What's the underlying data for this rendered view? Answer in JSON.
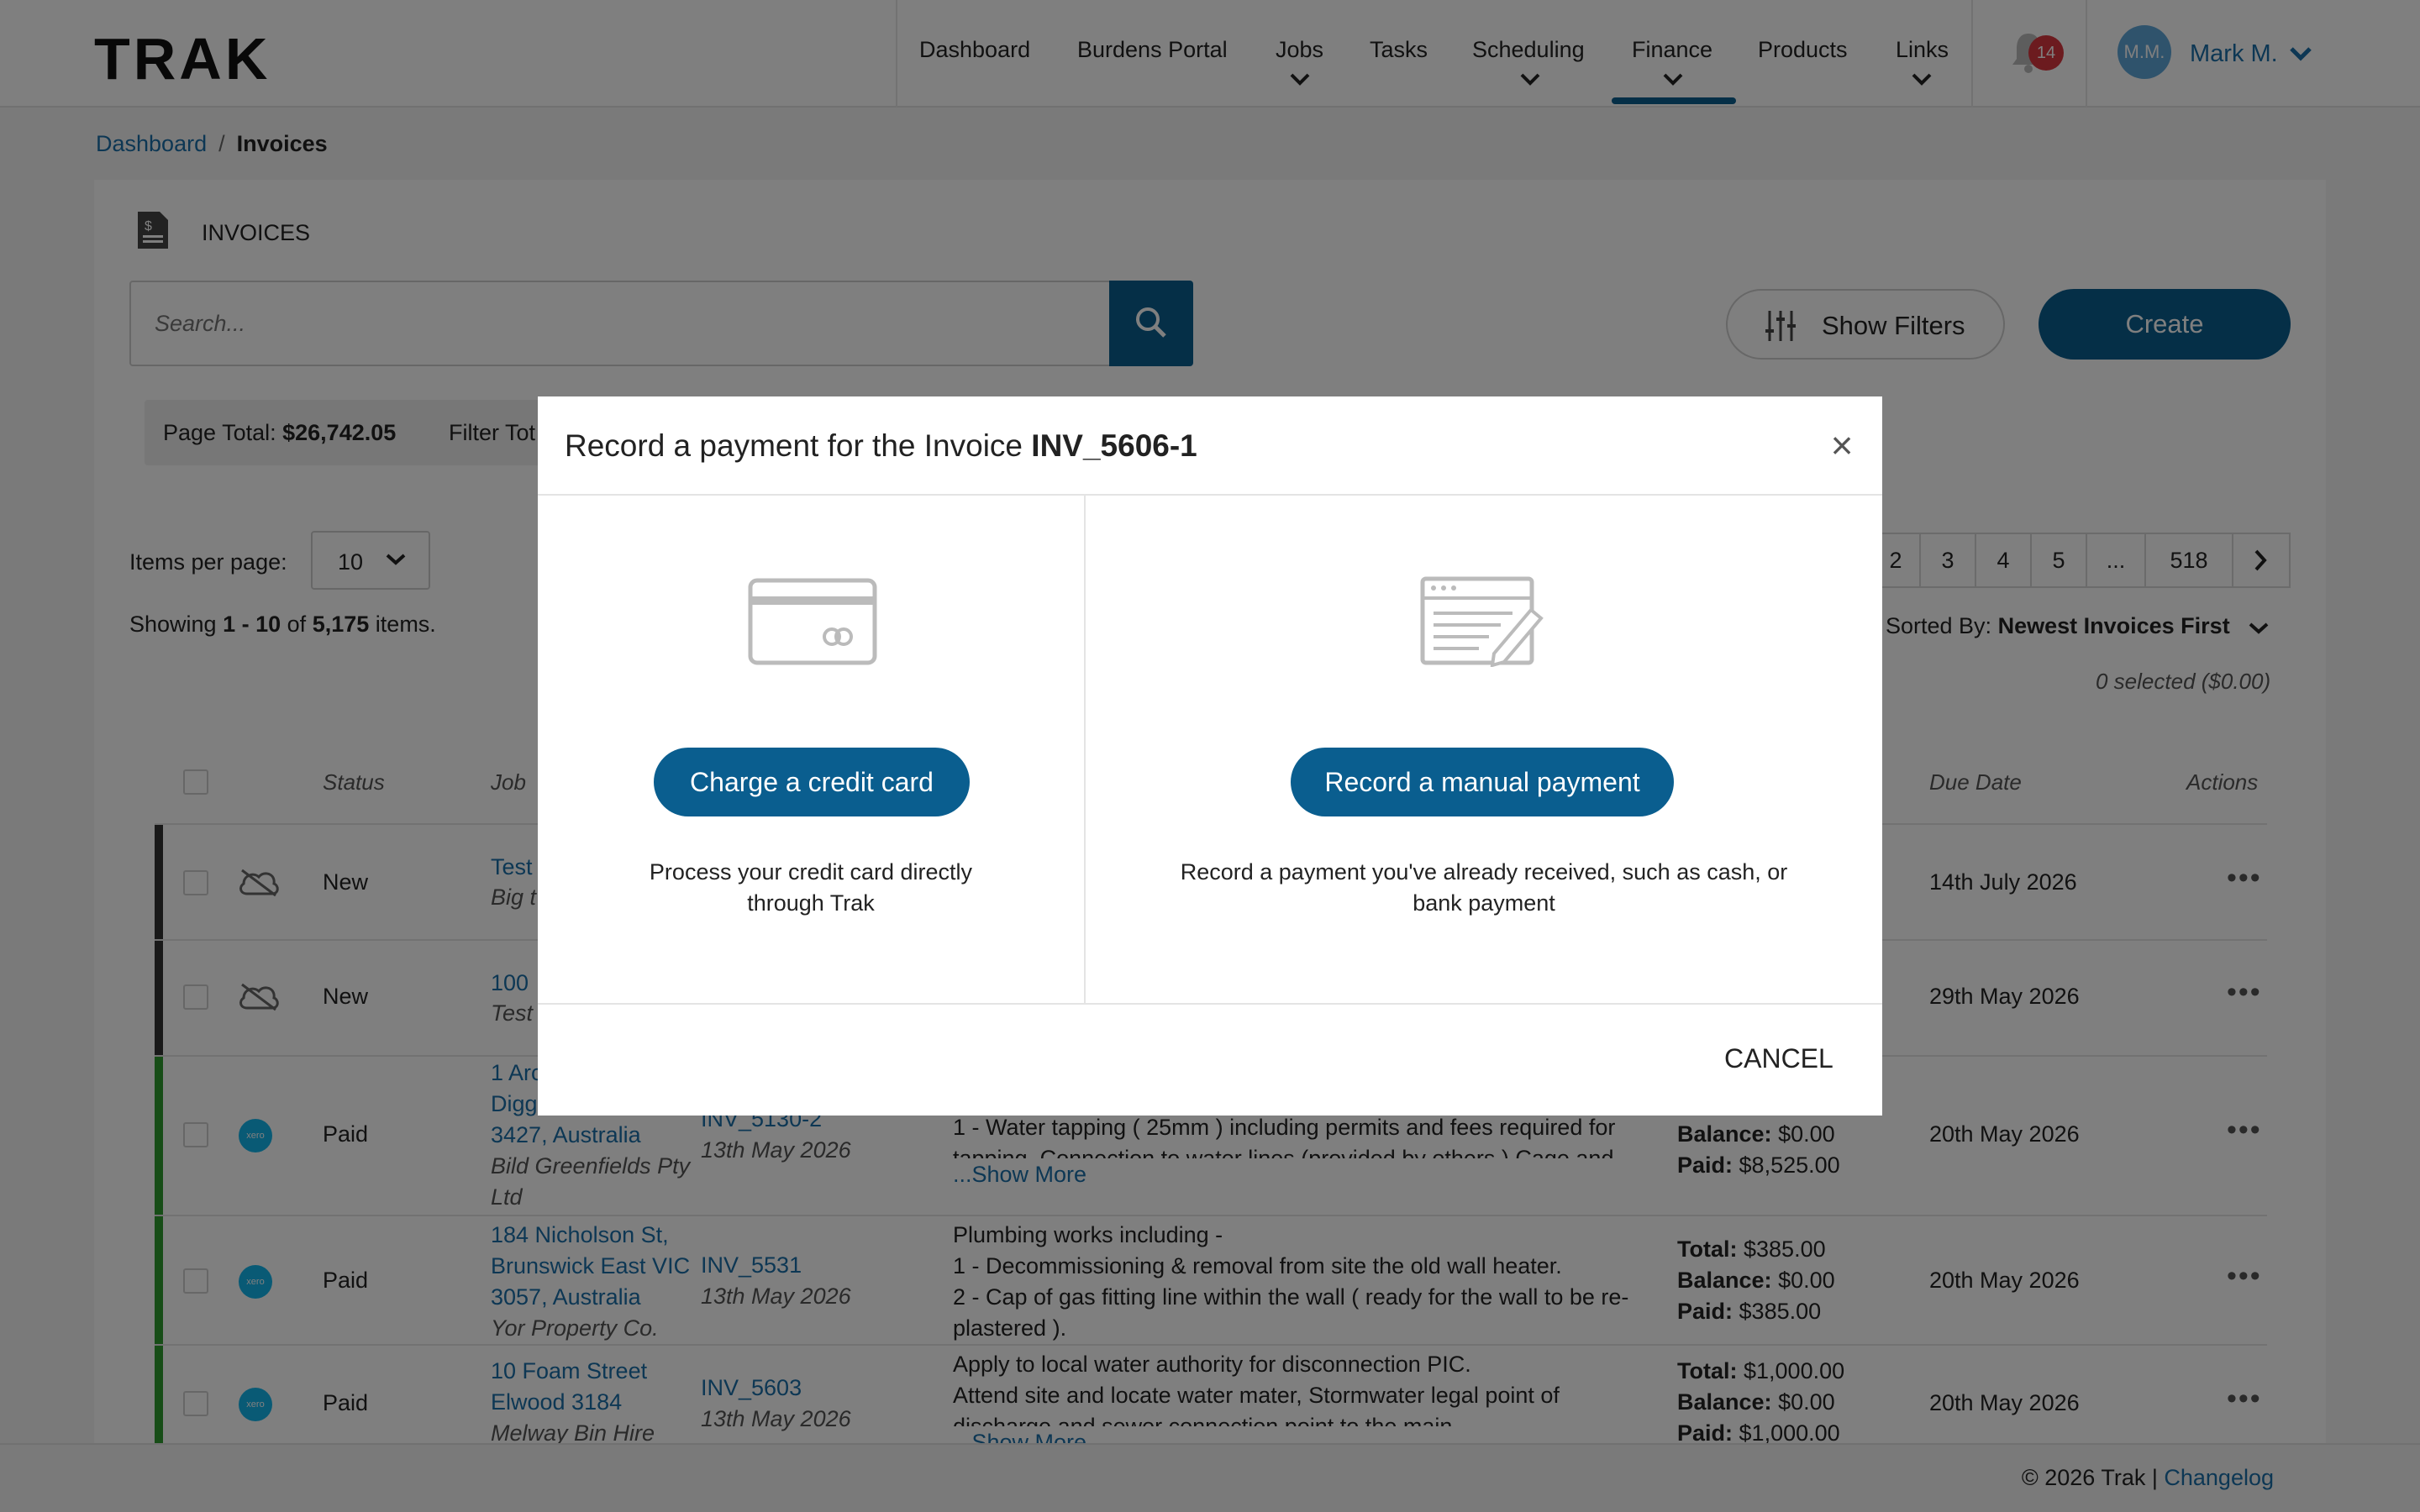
{
  "app": {
    "logo": "TRAK",
    "nav": [
      "Dashboard",
      "Burdens Portal",
      "Jobs",
      "Tasks",
      "Scheduling",
      "Finance",
      "Products",
      "Links"
    ],
    "active_nav": "Finance",
    "notification_count": "14",
    "user_initials": "M.M.",
    "user_name": "Mark M."
  },
  "breadcrumb": {
    "parent": "Dashboard",
    "separator": "/",
    "current": "Invoices"
  },
  "page": {
    "title": "INVOICES",
    "search_placeholder": "Search...",
    "show_filters": "Show Filters",
    "create": "Create",
    "page_total_label": "Page Total:",
    "page_total_value": "$26,742.05",
    "filter_total_label": "Filter Tot",
    "items_per_page_label": "Items per page:",
    "items_per_page_value": "10",
    "showing_prefix": "Showing",
    "showing_range": "1 - 10",
    "showing_of": "of",
    "showing_total": "5,175",
    "showing_suffix": "items.",
    "pagination": [
      "2",
      "3",
      "4",
      "5",
      "...",
      "518"
    ],
    "sorted_by_label": "Sorted By:",
    "sorted_by_value": "Newest Invoices First",
    "selected_info": "0 selected ($0.00)"
  },
  "table": {
    "headers": {
      "status": "Status",
      "job": "Job",
      "due_date": "Due Date",
      "actions": "Actions"
    },
    "rows": [
      {
        "status": "New",
        "job_link": "Test",
        "job_sub": "Big t",
        "due": "14th July 2026",
        "bar_color": "#333333",
        "sync": "cloud-off"
      },
      {
        "status": "New",
        "job_link": "100",
        "job_sub": "Test",
        "due": "29th May 2026",
        "bar_color": "#333333",
        "sync": "cloud-off"
      },
      {
        "status": "Paid",
        "job_link_lines": [
          "1 Arc",
          "Digg",
          "3427, Australia"
        ],
        "job_sub_lines": [
          "Bild Greenfields Pty",
          "Ltd"
        ],
        "inv": "INV_5130-2",
        "inv_date": "13th May 2026",
        "desc_lines": [
          "1 - Water tapping ( 25mm ) including permits and fees required for",
          "tapping. Connection to water lines (provided by others ) Cage and"
        ],
        "show_more": "...Show More",
        "balance": "$0.00",
        "paid": "$8,525.00",
        "due": "20th May 2026",
        "bar_color": "#2e9a2e",
        "sync": "xero"
      },
      {
        "status": "Paid",
        "job_link_lines": [
          "184 Nicholson St,",
          "Brunswick East VIC",
          "3057, Australia"
        ],
        "job_sub": "Yor Property Co.",
        "inv": "INV_5531",
        "inv_date": "13th May 2026",
        "desc_lines": [
          "Plumbing works including -",
          "1 - Decommissioning & removal from site the old wall heater.",
          "2 - Cap of gas fitting line within the wall ( ready for the wall to be re-",
          "plastered )."
        ],
        "total": "$385.00",
        "balance": "$0.00",
        "paid": "$385.00",
        "due": "20th May 2026",
        "bar_color": "#2e9a2e",
        "sync": "xero"
      },
      {
        "status": "Paid",
        "job_link_lines": [
          "10 Foam Street",
          "Elwood 3184"
        ],
        "job_sub": "Melway Bin Hire",
        "inv": "INV_5603",
        "inv_date": "13th May 2026",
        "desc_lines": [
          "Apply to local water authority for disconnection PIC.",
          "Attend site and locate water mater, Stormwater legal point of",
          "discharge and sewer connection point to the main"
        ],
        "show_more": "...Show More",
        "total": "$1,000.00",
        "balance": "$0.00",
        "paid": "$1,000.00",
        "due": "20th May 2026",
        "bar_color": "#2e9a2e",
        "sync": "xero"
      }
    ],
    "labels": {
      "total": "Total:",
      "balance": "Balance:",
      "paid": "Paid:",
      "xero": "xero"
    }
  },
  "footer": {
    "copyright": "© 2026 Trak |",
    "changelog": "Changelog"
  },
  "modal": {
    "title_prefix": "Record a payment for the Invoice",
    "invoice_number": "INV_5606-1",
    "close": "×",
    "credit_card_button": "Charge a credit card",
    "credit_card_desc_1": "Process your credit card directly",
    "credit_card_desc_2": "through Trak",
    "manual_button": "Record a manual payment",
    "manual_desc_1": "Record a payment you've already received, such as cash, or",
    "manual_desc_2": "bank payment",
    "cancel": "CANCEL"
  },
  "colors": {
    "primary": "#0a5e8f",
    "link": "#1a6fa8",
    "badge": "#d9363e",
    "paid_bar": "#2e9a2e",
    "new_bar": "#333333",
    "xero": "#13b5ea"
  }
}
